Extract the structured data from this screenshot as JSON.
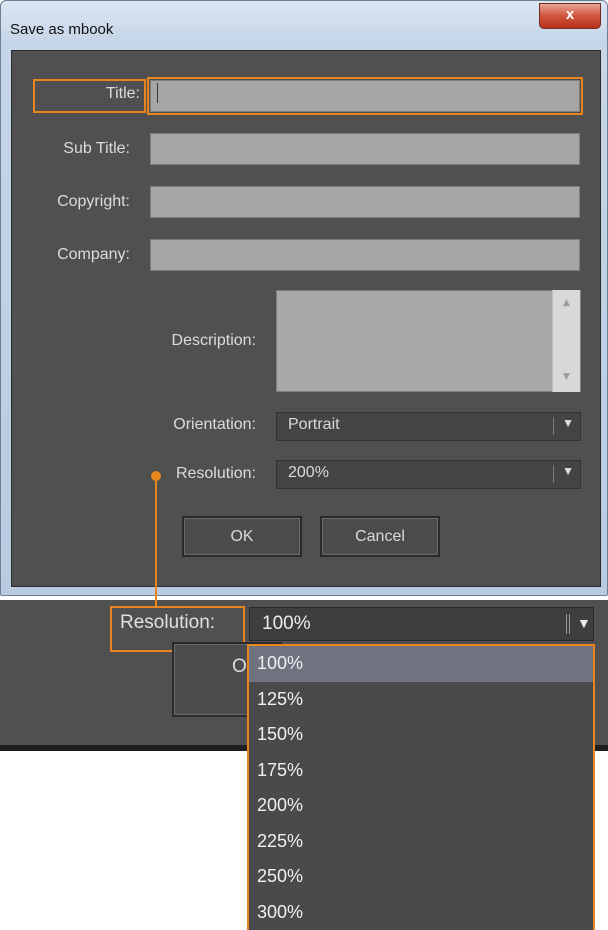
{
  "window": {
    "title": "Save as mbook",
    "close_label": "x"
  },
  "form": {
    "title_label": "Title:",
    "title_value": "",
    "subtitle_label": "Sub Title:",
    "subtitle_value": "",
    "copyright_label": "Copyright:",
    "copyright_value": "",
    "company_label": "Company:",
    "company_value": "",
    "description_label": "Description:",
    "description_value": "",
    "orientation_label": "Orientation:",
    "orientation_value": "Portrait",
    "resolution_label": "Resolution:",
    "resolution_value": "200%"
  },
  "buttons": {
    "ok": "OK",
    "cancel": "Cancel"
  },
  "zoom": {
    "resolution_label": "Resolution:",
    "resolution_value": "100%",
    "ok_partial": "Ok",
    "options": [
      "100%",
      "125%",
      "150%",
      "175%",
      "200%",
      "225%",
      "250%",
      "300%"
    ],
    "selected_index": 0
  },
  "colors": {
    "highlight": "#e8851d",
    "panel": "#505050",
    "field": "#a5a5a5"
  }
}
